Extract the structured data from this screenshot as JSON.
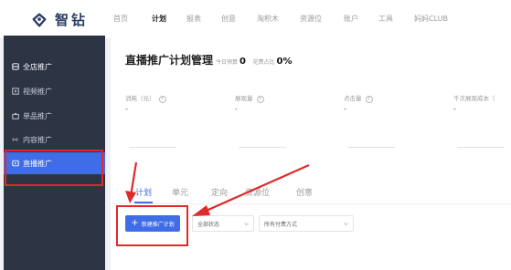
{
  "brand": {
    "name": "智钻"
  },
  "nav": [
    {
      "label": "首页"
    },
    {
      "label": "计划"
    },
    {
      "label": "报表"
    },
    {
      "label": "创意"
    },
    {
      "label": "淘积木"
    },
    {
      "label": "资源位"
    },
    {
      "label": "账户"
    },
    {
      "label": "工具"
    },
    {
      "label": "妈妈CLUB"
    }
  ],
  "sidebar": {
    "items": [
      {
        "label": "全店推广",
        "icon": "store-icon"
      },
      {
        "label": "视频推广",
        "icon": "video-icon"
      },
      {
        "label": "单品推广",
        "icon": "bag-icon"
      },
      {
        "label": "内容推广",
        "icon": "broadcast-icon"
      },
      {
        "label": "直播推广",
        "icon": "live-icon"
      }
    ]
  },
  "main": {
    "title": "直播推广计划管理",
    "budget_label": "今日预算",
    "budget_value": "0",
    "ratio_label": "花费占比",
    "ratio_value": "0%",
    "metrics": [
      {
        "label": "消耗（元）",
        "value": "-"
      },
      {
        "label": "展现量",
        "value": "-"
      },
      {
        "label": "点击量",
        "value": "-"
      },
      {
        "label": "千次展现成本（",
        "value": "-"
      }
    ],
    "tabs": [
      "计划",
      "单元",
      "定向",
      "资源位",
      "创意"
    ],
    "create_button": "新建推广计划",
    "status_select": "全部状态",
    "method_select": "所有付费方式"
  },
  "colors": {
    "accent": "#3f6de8",
    "sidebar_bg": "#2d3444",
    "annotation": "#e02a2a"
  }
}
